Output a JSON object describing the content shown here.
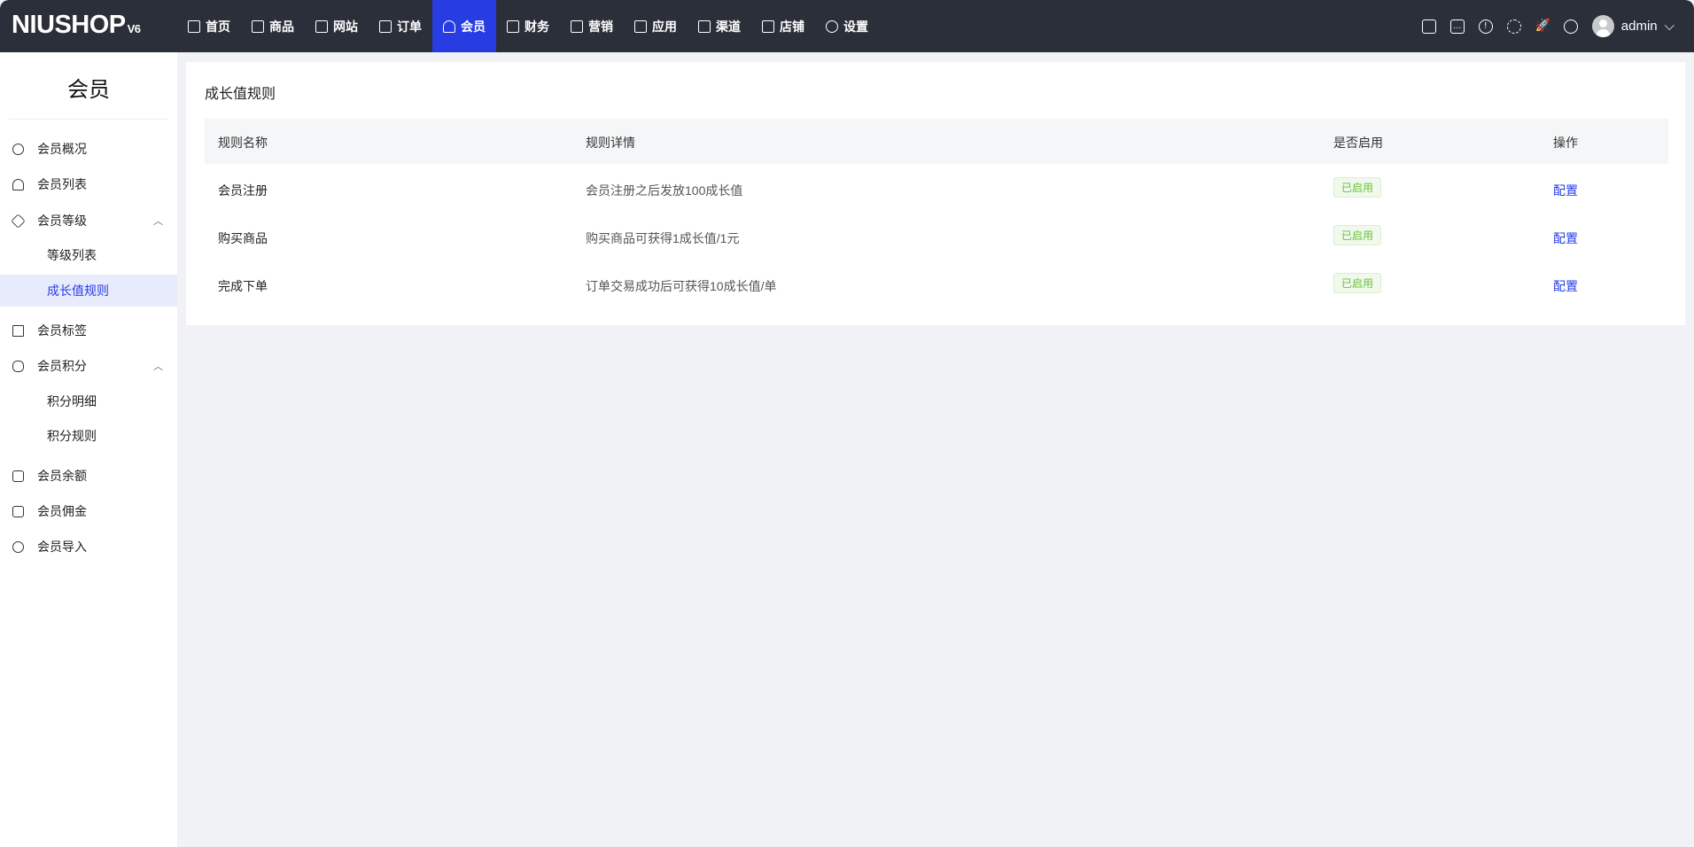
{
  "header": {
    "logo": "NIUSHOP",
    "logo_version": "V6",
    "nav": [
      {
        "label": "首页",
        "icon": "monitor-icon"
      },
      {
        "label": "商品",
        "icon": "box-icon"
      },
      {
        "label": "网站",
        "icon": "printer-icon"
      },
      {
        "label": "订单",
        "icon": "clipboard-icon"
      },
      {
        "label": "会员",
        "icon": "user-icon",
        "active": true
      },
      {
        "label": "财务",
        "icon": "wallet-icon"
      },
      {
        "label": "营销",
        "icon": "chart-icon"
      },
      {
        "label": "应用",
        "icon": "grid-icon"
      },
      {
        "label": "渠道",
        "icon": "screen-icon"
      },
      {
        "label": "店铺",
        "icon": "store-icon"
      },
      {
        "label": "设置",
        "icon": "gear-icon"
      }
    ],
    "user": "admin"
  },
  "sidebar": {
    "title": "会员",
    "items": [
      {
        "label": "会员概况"
      },
      {
        "label": "会员列表"
      },
      {
        "label": "会员等级"
      },
      {
        "label": "等级列表"
      },
      {
        "label": "成长值规则"
      },
      {
        "label": "会员标签"
      },
      {
        "label": "会员积分"
      },
      {
        "label": "积分明细"
      },
      {
        "label": "积分规则"
      },
      {
        "label": "会员余额"
      },
      {
        "label": "会员佣金"
      },
      {
        "label": "会员导入"
      }
    ]
  },
  "main": {
    "title": "成长值规则",
    "columns": [
      "规则名称",
      "规则详情",
      "是否启用",
      "操作"
    ],
    "rows": [
      {
        "name": "会员注册",
        "detail": "会员注册之后发放100成长值",
        "status": "已启用",
        "action": "配置"
      },
      {
        "name": "购买商品",
        "detail": "购买商品可获得1成长值/1元",
        "status": "已启用",
        "action": "配置"
      },
      {
        "name": "完成下单",
        "detail": "订单交易成功后可获得10成长值/单",
        "status": "已启用",
        "action": "配置"
      }
    ]
  },
  "colors": {
    "accent": "#273de3",
    "header_bg": "#2b2f3a",
    "success": "#67c23a"
  }
}
